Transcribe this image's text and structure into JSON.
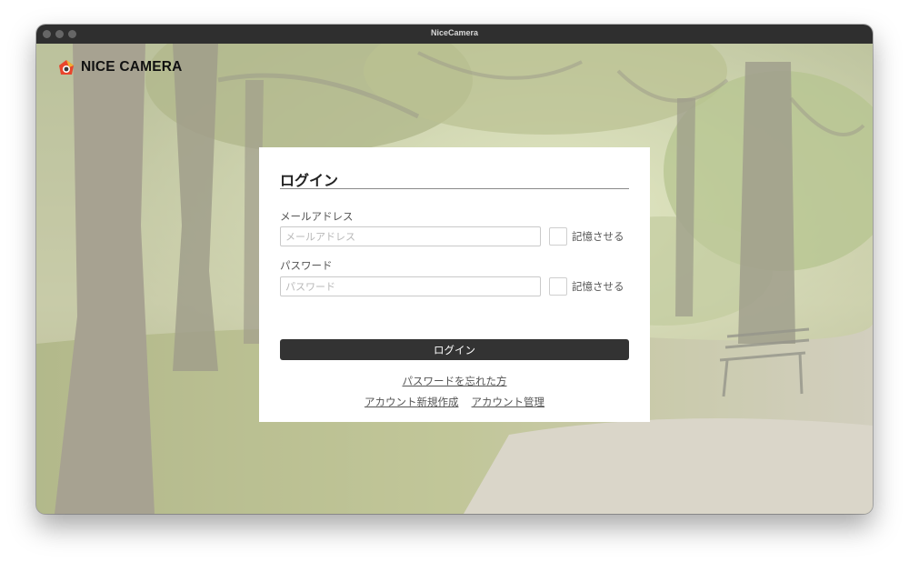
{
  "window": {
    "title": "NiceCamera"
  },
  "brand": {
    "name": "NICE CAMERA",
    "logo_icon": "camera-logo-icon",
    "logo_colors": [
      "#e8452c",
      "#f2b234",
      "#3a3a3a"
    ]
  },
  "login": {
    "title": "ログイン",
    "email": {
      "label": "メールアドレス",
      "value": "",
      "placeholder": "メールアドレス",
      "remember_label": "記憶させる",
      "remember_checked": false
    },
    "password": {
      "label": "パスワード",
      "value": "",
      "placeholder": "パスワード",
      "remember_label": "記憶させる",
      "remember_checked": false
    },
    "submit_label": "ログイン",
    "forgot_password_link": "パスワードを忘れた方",
    "create_account_link": "アカウント新規作成",
    "manage_account_link": "アカウント管理"
  },
  "colors": {
    "titlebar": "#2f2f2f",
    "button": "#333333",
    "card": "#ffffff",
    "background_tint": "#e6e8d8"
  },
  "background": {
    "description_icon": "park-photo-background"
  }
}
